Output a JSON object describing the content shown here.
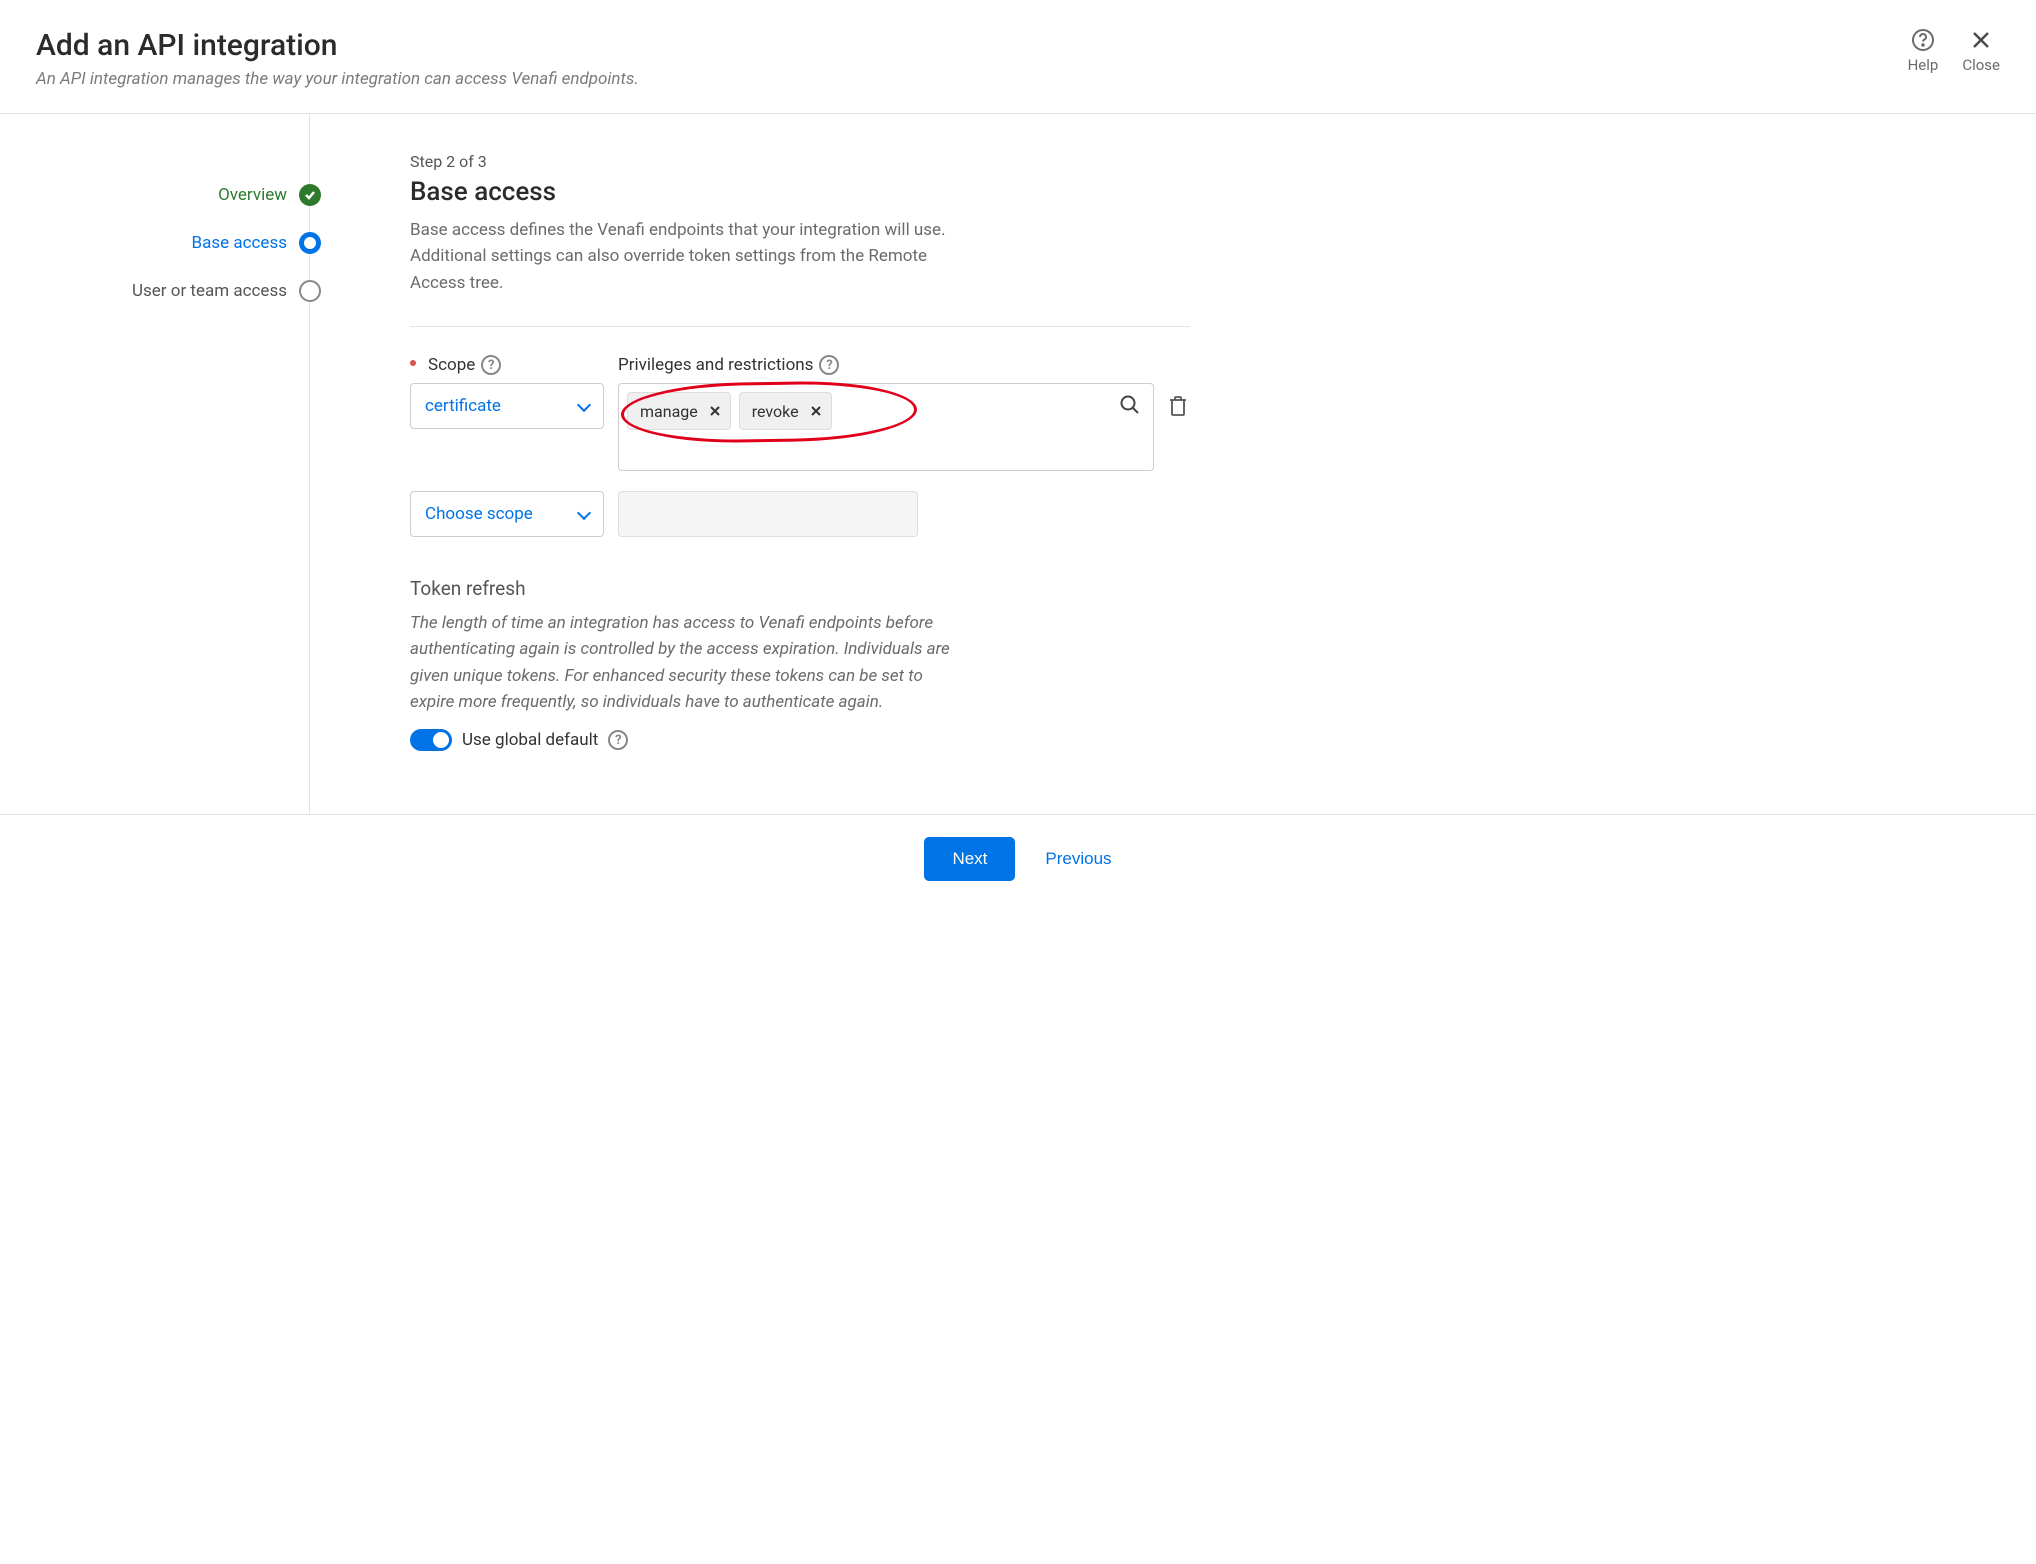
{
  "header": {
    "title": "Add an API integration",
    "subtitle": "An API integration manages the way your integration can access Venafi endpoints.",
    "help_label": "Help",
    "close_label": "Close"
  },
  "sidebar": {
    "steps": [
      {
        "label": "Overview",
        "state": "completed"
      },
      {
        "label": "Base access",
        "state": "current"
      },
      {
        "label": "User or team access",
        "state": "upcoming"
      }
    ]
  },
  "main": {
    "step_indicator": "Step 2 of 3",
    "heading": "Base access",
    "description": "Base access defines the Venafi endpoints that your integration will use. Additional settings can also override token settings from the Remote Access tree.",
    "scope_label": "Scope",
    "priv_label": "Privileges and restrictions",
    "rows": [
      {
        "scope_value": "certificate",
        "tags": [
          "manage",
          "revoke"
        ]
      },
      {
        "scope_value": "Choose scope",
        "tags": []
      }
    ],
    "token_refresh": {
      "heading": "Token refresh",
      "description": "The length of time an integration has access to Venafi endpoints before authenticating again is controlled by the access expiration. Individuals are given unique tokens. For enhanced security these tokens can be set to expire more frequently, so individuals have to authenticate again.",
      "toggle_label": "Use global default",
      "toggle_on": true
    }
  },
  "footer": {
    "next": "Next",
    "previous": "Previous"
  }
}
